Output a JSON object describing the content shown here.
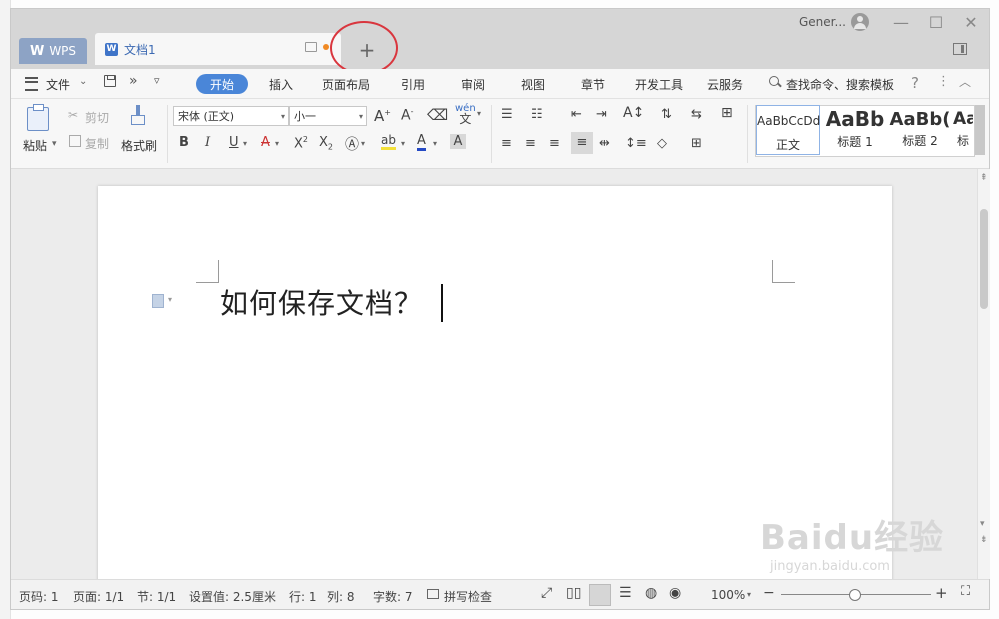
{
  "titlebar": {
    "user": "Gener...",
    "tab_wps": "WPS",
    "tab_doc": "文档1",
    "add_tab": "+"
  },
  "menu": {
    "file": "文件",
    "tabs": [
      "开始",
      "插入",
      "页面布局",
      "引用",
      "审阅",
      "视图",
      "章节",
      "开发工具",
      "云服务"
    ],
    "search": "查找命令、搜索模板",
    "help": "?"
  },
  "ribbon": {
    "paste": "粘贴",
    "cut": "剪切",
    "copy": "复制",
    "format_painter": "格式刷",
    "font_name": "宋体 (正文)",
    "font_size": "小一",
    "styles": [
      {
        "preview": "AaBbCcDd",
        "label": "正文"
      },
      {
        "preview": "AaBb",
        "label": "标题 1"
      },
      {
        "preview": "AaBb(",
        "label": "标题 2"
      },
      {
        "preview": "Aa",
        "label": "标"
      }
    ]
  },
  "document": {
    "text": "如何保存文档？"
  },
  "statusbar": {
    "page_num": "页码: 1",
    "pages": "页面: 1/1",
    "section": "节: 1/1",
    "setting": "设置值: 2.5厘米",
    "row": "行: 1",
    "col": "列: 8",
    "words": "字数: 7",
    "spell": "拼写检查",
    "zoom": "100%"
  },
  "watermark": {
    "brand": "Baidu",
    "cn": "经验",
    "url": "jingyan.baidu.com"
  }
}
